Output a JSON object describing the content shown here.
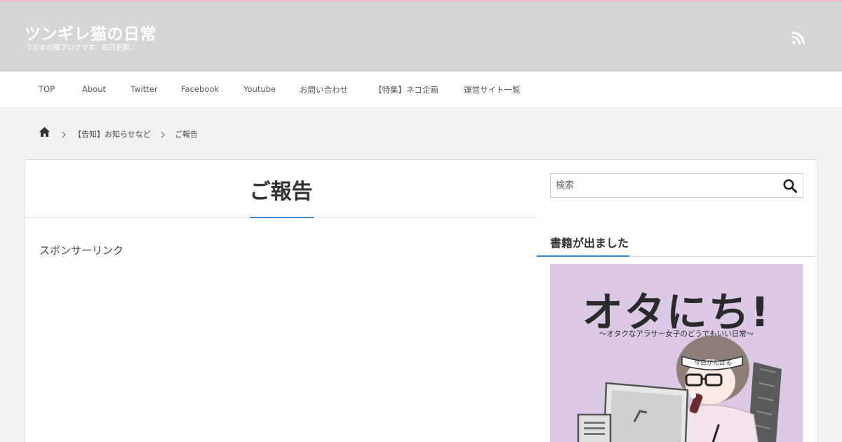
{
  "site": {
    "title": "ツンギレ猫の日常",
    "description": "うだまの猫ブログです。毎日更新。",
    "rss_icon": "rss-icon"
  },
  "colors": {
    "header_bg": "#d6d6d6",
    "header_top_border": "#f4b8cc",
    "accent": "#3a87c8",
    "book_bg": "#dbc8e6"
  },
  "nav": {
    "items": [
      {
        "label": "TOP"
      },
      {
        "label": "About"
      },
      {
        "label": "Twitter"
      },
      {
        "label": "Facebook"
      },
      {
        "label": "Youtube"
      },
      {
        "label": "お問い合わせ"
      },
      {
        "label": "【特集】ネコ企画"
      },
      {
        "label": "運営サイト一覧"
      }
    ]
  },
  "breadcrumb": {
    "home_icon": "home-icon",
    "category": "【告知】お知らせなど",
    "current": "ご報告"
  },
  "article": {
    "title": "ご報告",
    "sponsor_label": "スポンサーリンク"
  },
  "sidebar": {
    "search": {
      "placeholder": "検索",
      "value": "",
      "icon": "search-icon"
    },
    "widget_title": "書籍が出ました",
    "book": {
      "title": "オタにち!",
      "subtitle": "〜オタクなアラサー女子のどうでもいい日常〜",
      "headband_text": "今日がんばる"
    }
  }
}
